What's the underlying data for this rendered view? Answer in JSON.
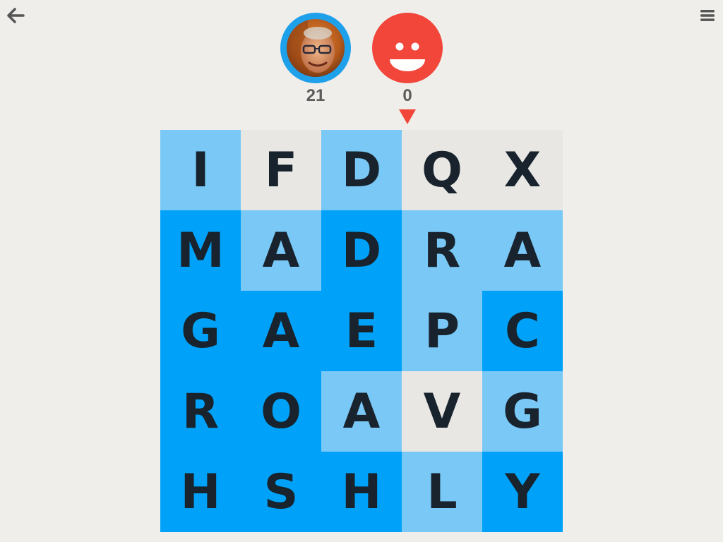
{
  "header": {
    "back_icon": "arrow-left-icon",
    "menu_icon": "hamburger-menu-icon"
  },
  "players": [
    {
      "avatar": "user-photo-avatar",
      "ring_color": "#1ea0ea",
      "score": "21"
    },
    {
      "avatar": "smiley-face-avatar",
      "color": "#f2463a",
      "score": "0",
      "current_turn": true
    }
  ],
  "colors": {
    "neutral": "#e8e7e4",
    "blue_light": "#79c8f6",
    "blue_dark": "#00a2f9",
    "red": "#f2463a",
    "background": "#efeeeb"
  },
  "board": {
    "rows": [
      [
        {
          "letter": "I",
          "owner": "light"
        },
        {
          "letter": "F",
          "owner": "neutral"
        },
        {
          "letter": "D",
          "owner": "light"
        },
        {
          "letter": "Q",
          "owner": "neutral"
        },
        {
          "letter": "X",
          "owner": "neutral"
        }
      ],
      [
        {
          "letter": "M",
          "owner": "dark"
        },
        {
          "letter": "A",
          "owner": "light"
        },
        {
          "letter": "D",
          "owner": "dark"
        },
        {
          "letter": "R",
          "owner": "light"
        },
        {
          "letter": "A",
          "owner": "light"
        }
      ],
      [
        {
          "letter": "G",
          "owner": "dark"
        },
        {
          "letter": "A",
          "owner": "dark"
        },
        {
          "letter": "E",
          "owner": "dark"
        },
        {
          "letter": "P",
          "owner": "light"
        },
        {
          "letter": "C",
          "owner": "dark"
        }
      ],
      [
        {
          "letter": "R",
          "owner": "dark"
        },
        {
          "letter": "O",
          "owner": "dark"
        },
        {
          "letter": "A",
          "owner": "light"
        },
        {
          "letter": "V",
          "owner": "neutral"
        },
        {
          "letter": "G",
          "owner": "light"
        }
      ],
      [
        {
          "letter": "H",
          "owner": "dark"
        },
        {
          "letter": "S",
          "owner": "dark"
        },
        {
          "letter": "H",
          "owner": "dark"
        },
        {
          "letter": "L",
          "owner": "light"
        },
        {
          "letter": "Y",
          "owner": "dark"
        }
      ]
    ]
  }
}
